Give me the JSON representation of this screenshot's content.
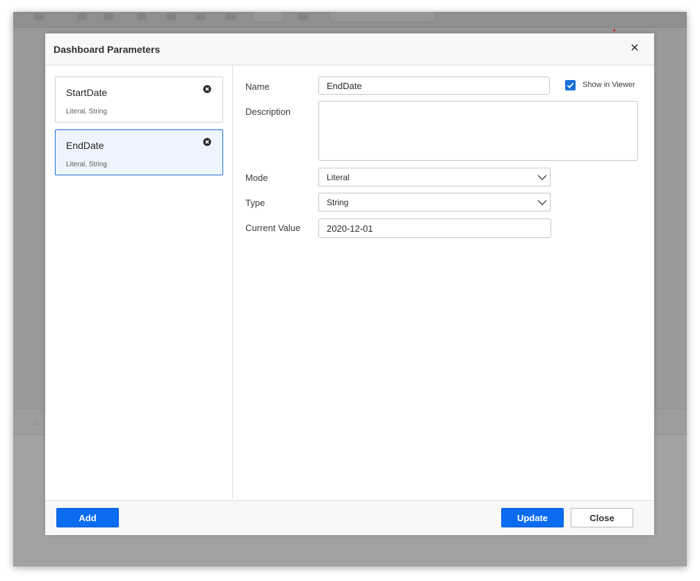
{
  "dialog": {
    "title": "Dashboard Parameters",
    "close_icon": "close-icon"
  },
  "parameters": [
    {
      "name": "StartDate",
      "subtitle": "Literal, String",
      "selected": false
    },
    {
      "name": "EndDate",
      "subtitle": "Literal, String",
      "selected": true
    }
  ],
  "editor": {
    "name_label": "Name",
    "name_value": "EndDate",
    "show_in_viewer_label": "Show in Viewer",
    "show_in_viewer_checked": true,
    "description_label": "Description",
    "description_value": "",
    "mode_label": "Mode",
    "mode_value": "Literal",
    "type_label": "Type",
    "type_value": "String",
    "current_value_label": "Current Value",
    "current_value": "2020-12-01"
  },
  "footer": {
    "add_label": "Add",
    "update_label": "Update",
    "close_label": "Close"
  },
  "colors": {
    "accent": "#0a6cf1",
    "selected_bg": "#eef5fe",
    "overlay": "#9a9a9a"
  }
}
